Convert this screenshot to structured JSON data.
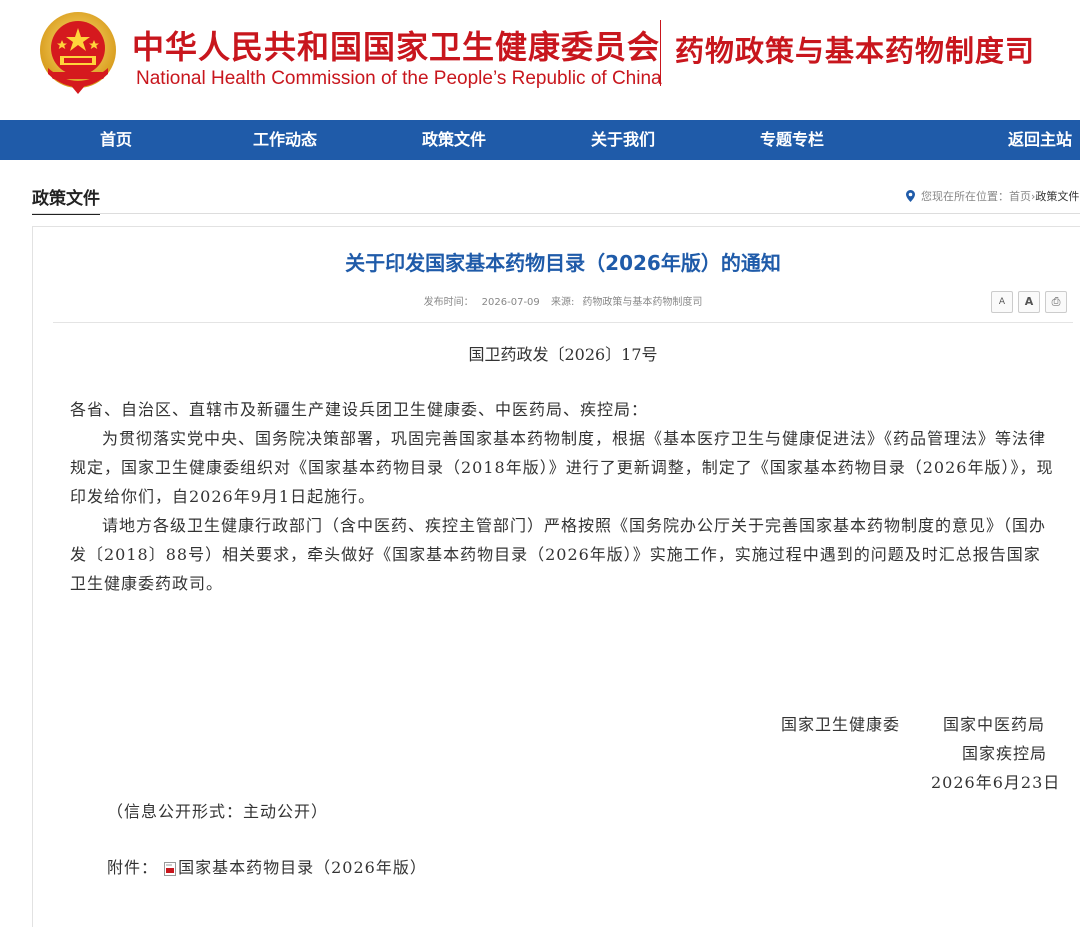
{
  "header": {
    "title_cn": "中华人民共和国国家卫生健康委员会",
    "title_en": "National Health Commission of the People’s  Republic of China",
    "dept_name": "药物政策与基本药物制度司"
  },
  "nav": {
    "items": [
      "首页",
      "工作动态",
      "政策文件",
      "关于我们",
      "专题专栏"
    ],
    "return_label": "返回主站"
  },
  "breadcrumb": {
    "section_title": "政策文件",
    "location_label": "您现在所在位置：",
    "home": "首页",
    "sep": "›",
    "current": "政策文件"
  },
  "article": {
    "title": "关于印发国家基本药物目录（2026年版）的通知",
    "publish_label": "发布时间：",
    "publish_date": "2026-07-09",
    "source_label": "来源:",
    "source": "药物政策与基本药物制度司",
    "tools": {
      "font_smaller": "A",
      "font_larger": "A",
      "print": "⎙"
    },
    "doc_number": "国卫药政发〔2026〕17号",
    "recipients": "各省、自治区、直辖市及新疆生产建设兵团卫生健康委、中医药局、疾控局：",
    "para1": "为贯彻落实党中央、国务院决策部署，巩固完善国家基本药物制度，根据《基本医疗卫生与健康促进法》《药品管理法》等法律规定，国家卫生健康委组织对《国家基本药物目录（2018年版）》进行了更新调整，制定了《国家基本药物目录（2026年版）》，现印发给你们，自2026年9月1日起施行。",
    "para2": "请地方各级卫生健康行政部门（含中医药、疾控主管部门）严格按照《国务院办公厅关于完善国家基本药物制度的意见》（国办发〔2018〕88号）相关要求，牵头做好《国家基本药物目录（2026年版）》实施工作，实施过程中遇到的问题及时汇总报告国家卫生健康委药政司。",
    "signatories": {
      "line1_a": "国家卫生健康委",
      "line1_b": "国家中医药局",
      "line2": "国家疾控局",
      "date": "2026年6月23日"
    },
    "disclosure": "（信息公开形式：主动公开）",
    "attachment_label": "附件：",
    "attachment_name": "国家基本药物目录（2026年版）"
  },
  "colors": {
    "brand_red": "#c8161d",
    "nav_blue": "#1f5ba9",
    "title_blue": "#1f5ba9"
  }
}
